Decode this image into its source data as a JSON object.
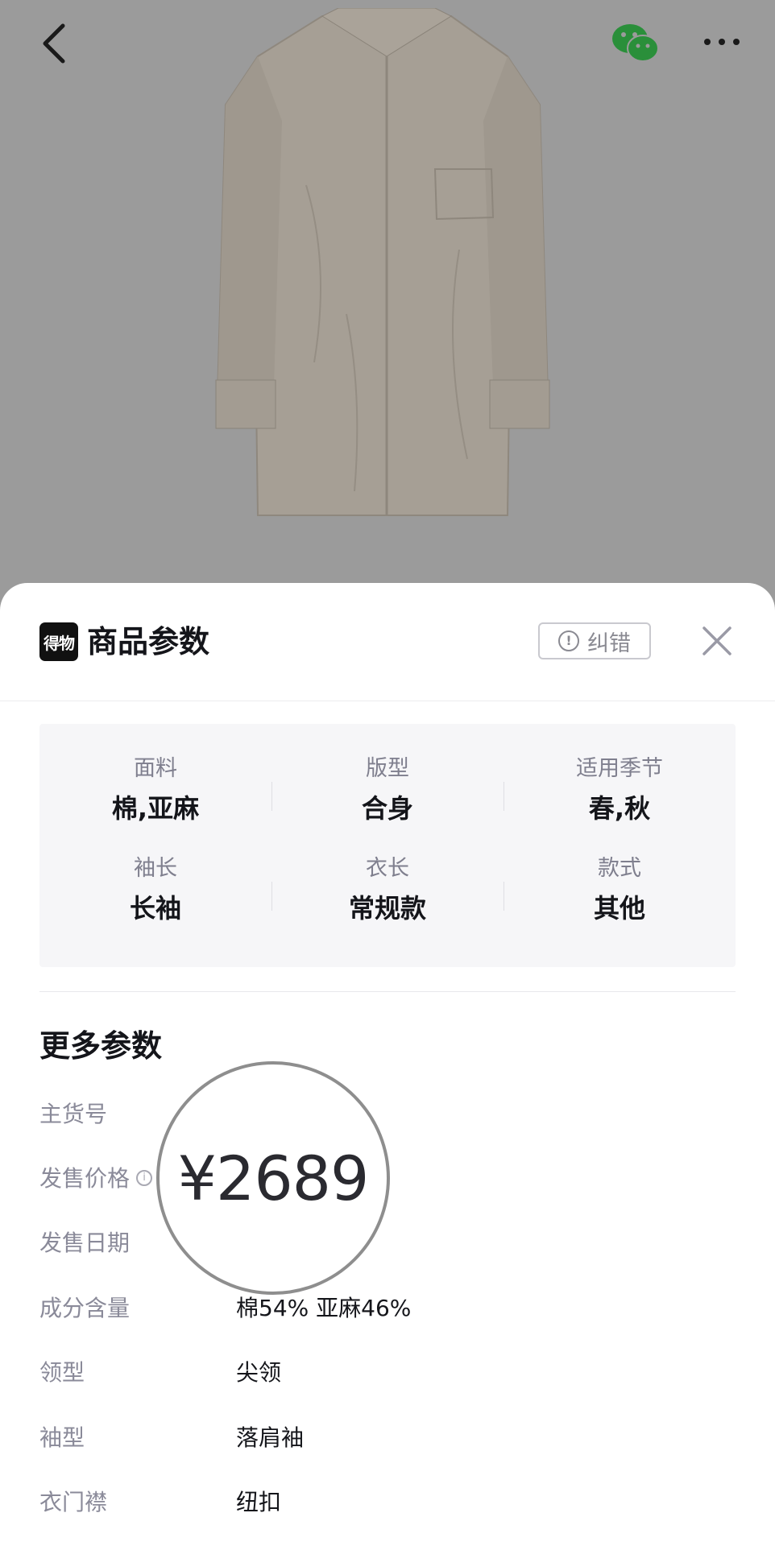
{
  "sheet": {
    "brand_logo_text": "得物",
    "title": "商品参数",
    "report_label": "纠错",
    "report_icon_glyph": "!"
  },
  "key_params": [
    {
      "label": "面料",
      "value": "棉,亚麻"
    },
    {
      "label": "版型",
      "value": "合身"
    },
    {
      "label": "适用季节",
      "value": "春,秋"
    },
    {
      "label": "袖长",
      "value": "长袖"
    },
    {
      "label": "衣长",
      "value": "常规款"
    },
    {
      "label": "款式",
      "value": "其他"
    }
  ],
  "more_params": {
    "title": "更多参数",
    "rows": [
      {
        "key": "主货号",
        "value": ""
      },
      {
        "key": "发售价格",
        "value": "",
        "info_icon": "i"
      },
      {
        "key": "发售日期",
        "value": ""
      },
      {
        "key": "成分含量",
        "value": "棉54% 亚麻46%"
      },
      {
        "key": "领型",
        "value": "尖领"
      },
      {
        "key": "袖型",
        "value": "落肩袖"
      },
      {
        "key": "衣门襟",
        "value": "纽扣"
      }
    ]
  },
  "magnifier_text": "¥2689",
  "icons": [
    "back-arrow-icon",
    "wechat-icon",
    "more-dots-icon",
    "close-icon",
    "info-icon",
    "report-icon"
  ],
  "colors": {
    "overlay": "#9b9b9b",
    "sheet_bg": "#ffffff",
    "param_box_bg": "#f6f6f8",
    "label_gray": "#7f7f8e",
    "wechat_green": "#2a8f3a"
  }
}
